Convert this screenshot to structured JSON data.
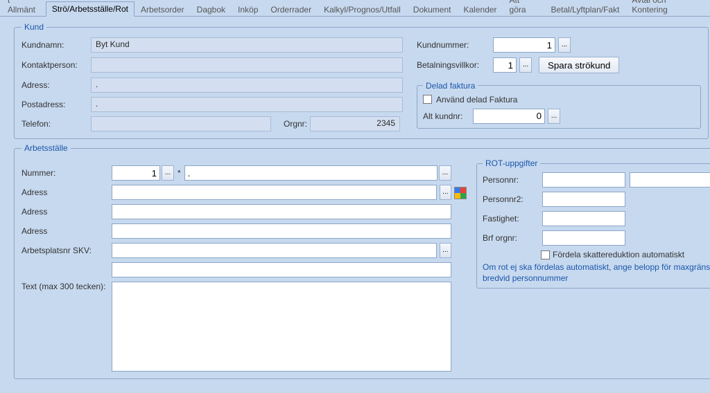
{
  "tabs": [
    {
      "label": "t Allmänt"
    },
    {
      "label": "Strö/Arbetsställe/Rot"
    },
    {
      "label": "Arbetsorder"
    },
    {
      "label": "Dagbok"
    },
    {
      "label": "Inköp"
    },
    {
      "label": "Orderrader"
    },
    {
      "label": "Kalkyl/Prognos/Utfall"
    },
    {
      "label": "Dokument"
    },
    {
      "label": "Kalender"
    },
    {
      "label": "Att göra"
    },
    {
      "label": "Betal/Lyftplan/Fakt"
    },
    {
      "label": "Avtal och Kontering"
    }
  ],
  "kund": {
    "legend": "Kund",
    "kundnamn_label": "Kundnamn:",
    "kundnamn_value": "Byt Kund",
    "kontaktperson_label": "Kontaktperson:",
    "kontaktperson_value": "",
    "adress_label": "Adress:",
    "adress_value": ".",
    "postadress_label": "Postadress:",
    "postadress_value": ".",
    "telefon_label": "Telefon:",
    "telefon_value": "",
    "orgnr_label": "Orgnr:",
    "orgnr_value": "2345",
    "kundnummer_label": "Kundnummer:",
    "kundnummer_value": "1",
    "betalningsvillkor_label": "Betalningsvillkor:",
    "betalningsvillkor_value": "1",
    "spara_btn": "Spara strökund",
    "ellipsis": "..."
  },
  "delad": {
    "legend": "Delad faktura",
    "anvand_label": "Använd delad Faktura",
    "alt_kundnr_label": "Alt kundnr:",
    "alt_kundnr_value": "0",
    "ellipsis": "..."
  },
  "arbets": {
    "legend": "Arbetsställe",
    "nummer_label": "Nummer:",
    "nummer_value": "1",
    "nummer_sep": "*",
    "nummer_extra_value": ".",
    "adress_label": "Adress",
    "adress1_value": "",
    "adress2_value": "",
    "adress3_value": "",
    "skv_label": "Arbetsplatsnr SKV:",
    "skv_value": "",
    "extra_value": "",
    "text_label": "Text (max 300 tecken):",
    "text_value": "",
    "ellipsis": "..."
  },
  "rot": {
    "legend": "ROT-uppgifter",
    "personnr_label": "Personnr:",
    "personnr_value": "",
    "personnr_extra": "",
    "personnr2_label": "Personnr2:",
    "personnr2_value": "",
    "fastighet_label": "Fastighet:",
    "fastighet_value": "",
    "brf_label": "Brf orgnr:",
    "brf_value": "",
    "fordela_label": "Fördela skattereduktion automatiskt",
    "hint": "Om rot ej ska fördelas automatiskt, ange belopp för maxgräns i rutorna bredvid personnummer"
  }
}
